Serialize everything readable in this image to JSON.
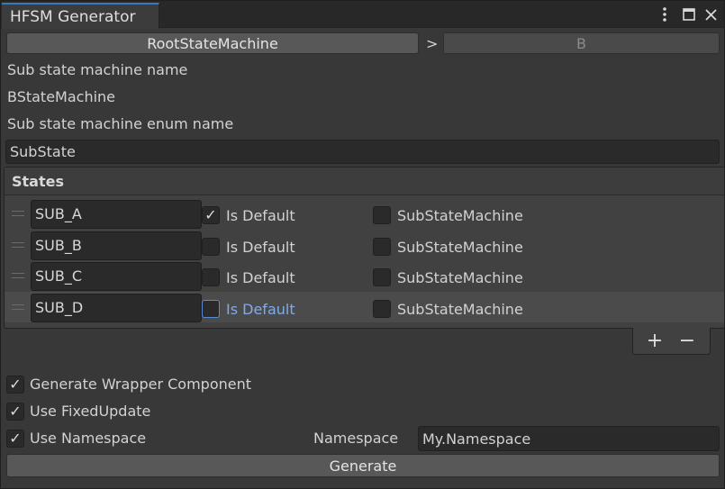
{
  "window": {
    "tab_title": "HFSM Generator",
    "menu_icon": "kebab-menu-icon",
    "maximize_icon": "maximize-icon",
    "close_icon": "close-icon"
  },
  "breadcrumb": {
    "root_label": "RootStateMachine",
    "separator": ">",
    "current_label": "B"
  },
  "sub_state_machine": {
    "name_label": "Sub state machine name",
    "name_value": "BStateMachine",
    "enum_label": "Sub state machine enum name",
    "enum_value": "SubState"
  },
  "states": {
    "header": "States",
    "is_default_label": "Is Default",
    "sub_state_machine_label": "SubStateMachine",
    "rows": [
      {
        "name": "SUB_A",
        "is_default": true,
        "sub_state_machine": false
      },
      {
        "name": "SUB_B",
        "is_default": false,
        "sub_state_machine": false
      },
      {
        "name": "SUB_C",
        "is_default": false,
        "sub_state_machine": false
      },
      {
        "name": "SUB_D",
        "is_default": false,
        "sub_state_machine": false
      }
    ],
    "add_label": "+",
    "remove_label": "−"
  },
  "options": {
    "generate_wrapper_label": "Generate Wrapper Component",
    "generate_wrapper_checked": true,
    "fixed_update_label": "Use FixedUpdate",
    "fixed_update_checked": true,
    "use_namespace_label": "Use Namespace",
    "use_namespace_checked": true,
    "namespace_label": "Namespace",
    "namespace_value": "My.Namespace"
  },
  "generate_label": "Generate",
  "colors": {
    "panel_bg": "#383838",
    "tab_accent": "#3a79bb",
    "focus_blue": "#80abe8"
  }
}
